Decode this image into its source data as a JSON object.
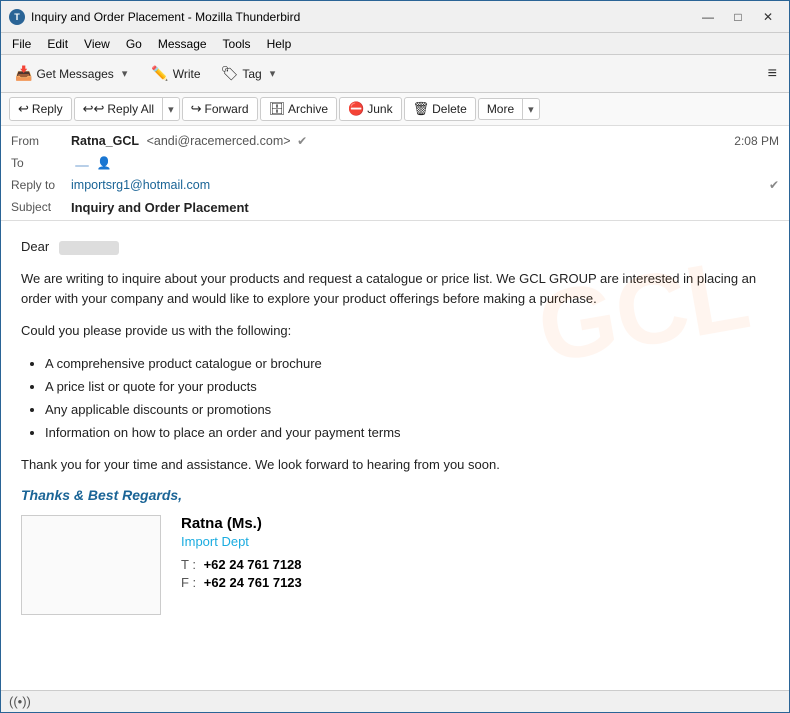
{
  "window": {
    "title": "Inquiry and Order Placement - Mozilla Thunderbird",
    "icon": "T"
  },
  "window_controls": {
    "minimize": "—",
    "maximize": "□",
    "close": "✕"
  },
  "menu": {
    "items": [
      "File",
      "Edit",
      "View",
      "Go",
      "Message",
      "Tools",
      "Help"
    ]
  },
  "toolbar": {
    "get_messages_label": "Get Messages",
    "write_label": "Write",
    "tag_label": "Tag",
    "dropdown_char": "▾",
    "menu_char": "≡"
  },
  "action_bar": {
    "from_label": "From",
    "reply_label": "Reply",
    "reply_all_label": "Reply All",
    "forward_label": "Forward",
    "archive_label": "Archive",
    "junk_label": "Junk",
    "delete_label": "Delete",
    "more_label": "More",
    "dropdown_char": "▾"
  },
  "email_meta": {
    "from_label": "From",
    "from_name": "Ratna_GCL",
    "from_email": "<andi@racemerced.com>",
    "to_label": "To",
    "to_chip": "",
    "time": "2:08 PM",
    "reply_to_label": "Reply to",
    "reply_to_email": "importsrg1@hotmail.com",
    "subject_label": "Subject",
    "subject_value": "Inquiry and Order Placement"
  },
  "email_body": {
    "greeting": "Dear",
    "greeting_name": "",
    "paragraph1": "We are writing to inquire about your products and request a catalogue or price list. We GCL GROUP are interested in placing an order with your company and would like to explore your product offerings before making a purchase.",
    "paragraph2": "Could you please provide us with the following:",
    "list_items": [
      "A comprehensive product catalogue or brochure",
      "A price list or quote for your products",
      "Any applicable discounts or promotions",
      "Information on how to place an order and your payment terms"
    ],
    "paragraph3": "Thank you for your time and assistance. We look forward to hearing from you soon.",
    "closing": "Thanks & Best Regards,",
    "sig_name": "Ratna (Ms.)",
    "sig_dept": "Import Dept",
    "sig_phone_label": "T :",
    "sig_phone": "+62 24 761 7128",
    "sig_fax_label": "F :",
    "sig_fax": "+62 24 761 7123"
  },
  "status_bar": {
    "icon": "((•))",
    "text": ""
  }
}
